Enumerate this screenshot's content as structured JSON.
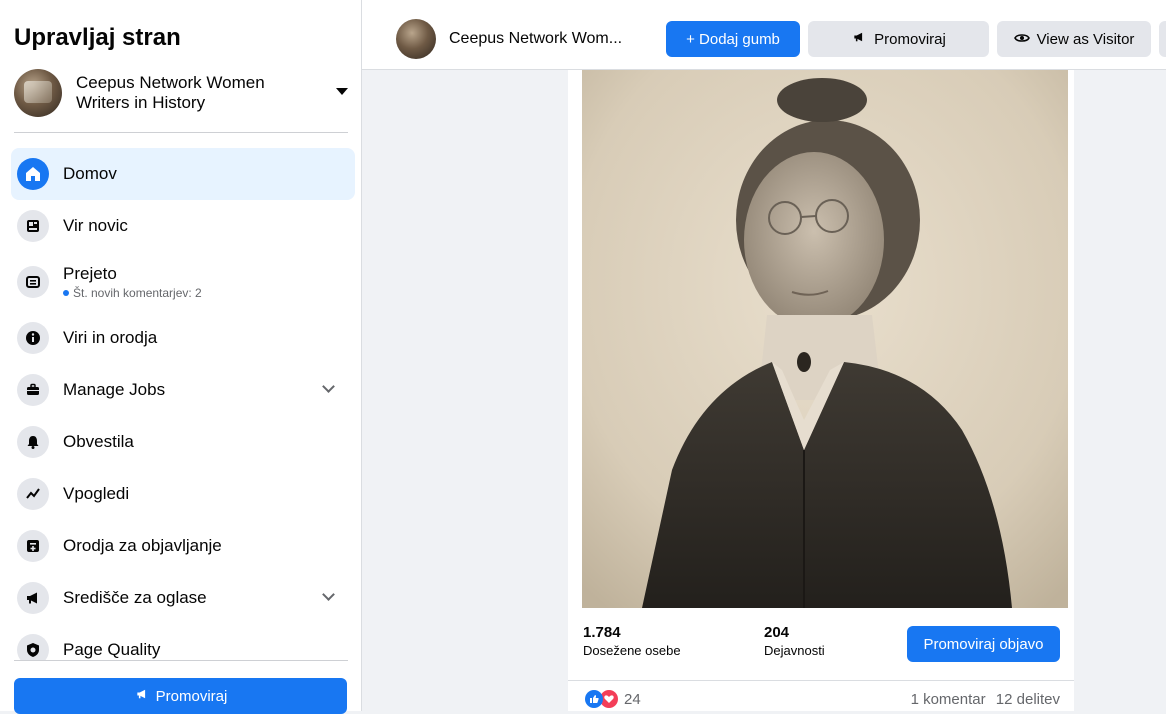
{
  "sidebar": {
    "title": "Upravljaj stran",
    "page_name": "Ceepus Network Women Writers in History",
    "items": [
      {
        "label": "Domov",
        "icon": "home-icon",
        "active": true
      },
      {
        "label": "Vir novic",
        "icon": "news-feed-icon"
      },
      {
        "label": "Prejeto",
        "icon": "inbox-icon",
        "sub": "Št. novih komentarjev: 2"
      },
      {
        "label": "Viri in orodja",
        "icon": "info-icon"
      },
      {
        "label": "Manage Jobs",
        "icon": "briefcase-icon",
        "expandable": true
      },
      {
        "label": "Obvestila",
        "icon": "bell-icon"
      },
      {
        "label": "Vpogledi",
        "icon": "insights-icon"
      },
      {
        "label": "Orodja za objavljanje",
        "icon": "publishing-tools-icon"
      },
      {
        "label": "Središče za oglase",
        "icon": "megaphone-icon",
        "expandable": true
      },
      {
        "label": "Page Quality",
        "icon": "shield-icon"
      }
    ],
    "promote_label": "Promoviraj"
  },
  "topbar": {
    "page_name": "Ceepus Network Wom...",
    "add_button_label": "+ Dodaj gumb",
    "promote_label": "Promoviraj",
    "view_as_label": "View as Visitor"
  },
  "post": {
    "reach_value": "1.784",
    "reach_label": "Dosežene osebe",
    "engagement_value": "204",
    "engagement_label": "Dejavnosti",
    "boost_label": "Promoviraj objavo",
    "reaction_count": "24",
    "comments": "1 komentar",
    "shares": "12 delitev"
  },
  "colors": {
    "accent": "#1877f2",
    "active_bg": "#e7f3ff",
    "love": "#f33e58"
  }
}
